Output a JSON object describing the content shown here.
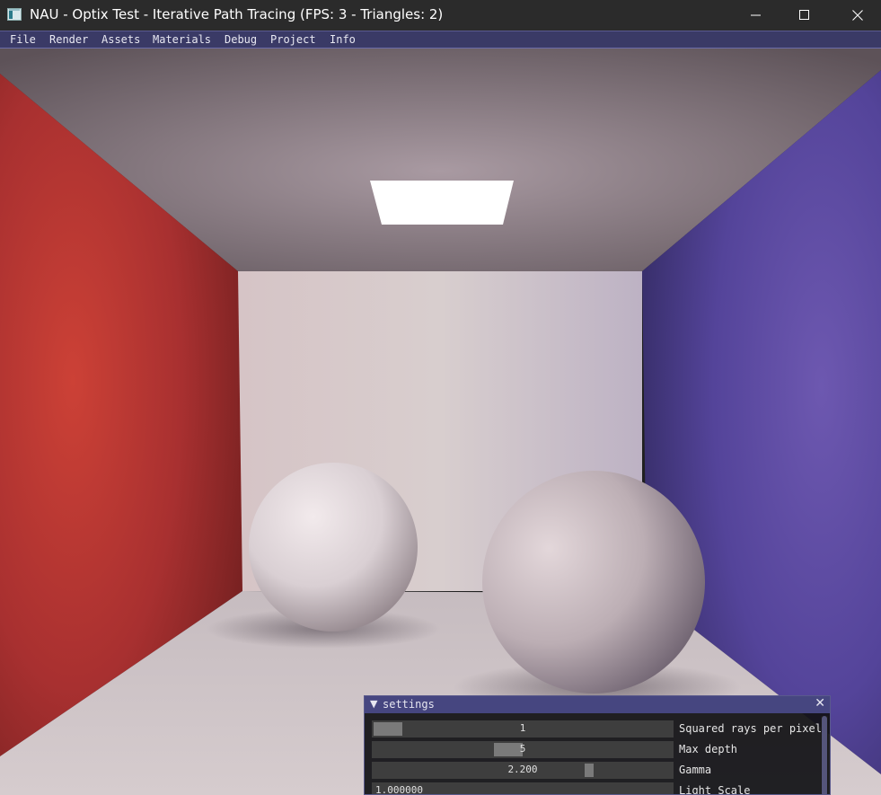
{
  "window": {
    "title": "NAU - Optix Test - Iterative Path Tracing (FPS: 3 - Triangles: 2)",
    "icon": "app-window-icon",
    "controls": [
      "minimize-icon",
      "maximize-icon",
      "close-icon"
    ]
  },
  "menu": {
    "items": [
      "File",
      "Render",
      "Assets",
      "Materials",
      "Debug",
      "Project",
      "Info"
    ]
  },
  "settings": {
    "title": "settings",
    "collapse_icon": "▼",
    "close_icon": "✕",
    "rows": [
      {
        "value": "1",
        "label": "Squared rays per pixel",
        "fraction": 0.05
      },
      {
        "value": "5",
        "label": "Max depth",
        "fraction": 0.45
      },
      {
        "value": "2.200",
        "label": "Gamma",
        "fraction": 0.71
      },
      {
        "value": "1.000000",
        "label": "Light Scale",
        "fraction": 0.0
      }
    ]
  },
  "colors": {
    "menubar": "#3a3a66",
    "panel_title": "#464680",
    "left_wall": "#b83838",
    "right_wall": "#5a4a9c",
    "back_wall": "#d8cccc"
  }
}
